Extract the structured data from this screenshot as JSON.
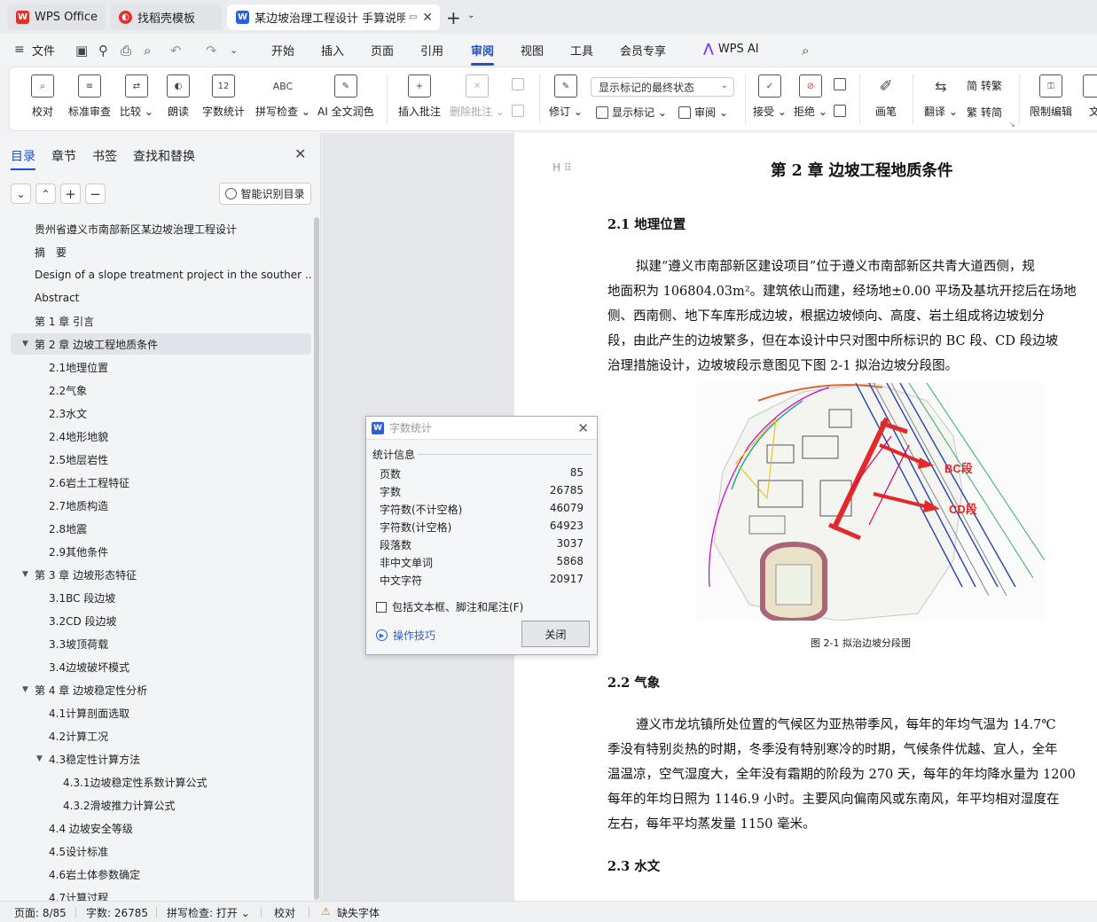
{
  "tabs": [
    {
      "label": "WPS Office",
      "icon": "wps-logo-icon"
    },
    {
      "label": "找稻壳模板",
      "icon": "docer-icon"
    },
    {
      "label": "某边坡治理工程设计 手算说明",
      "icon": "writer-doc-icon",
      "active": true
    }
  ],
  "menu": {
    "file": "文件",
    "items": [
      "开始",
      "插入",
      "页面",
      "引用",
      "审阅",
      "视图",
      "工具",
      "会员专享"
    ],
    "active": "审阅",
    "ai": "WPS AI"
  },
  "ribbon": {
    "proofread": "校对",
    "standard_review": "标准审查",
    "compare": "比较",
    "read_aloud": "朗读",
    "word_count": "字数统计",
    "spell_check": "拼写检查",
    "ai_polish": "AI 全文润色",
    "insert_comment": "插入批注",
    "delete_comment": "删除批注",
    "track_changes": "修订",
    "show_markup": "显示标记",
    "review": "审阅",
    "markup_state": "显示标记的最终状态",
    "accept": "接受",
    "reject": "拒绝",
    "pen": "画笔",
    "translate": "翻译",
    "to_traditional": "转繁",
    "to_simplified": "转简",
    "restrict_edit": "限制编辑",
    "doc_more": "文"
  },
  "nav": {
    "tabs": [
      "目录",
      "章节",
      "书签",
      "查找和替换"
    ],
    "smart_toc": "智能识别目录",
    "toc": [
      {
        "label": "贵州省遵义市南部新区某边坡治理工程设计",
        "level": 1
      },
      {
        "label": "摘　要",
        "level": 1
      },
      {
        "label": "Design of a slope treatment project in the souther ...",
        "level": 1
      },
      {
        "label": "Abstract",
        "level": 1
      },
      {
        "label": "第 1 章  引言",
        "level": 1
      },
      {
        "label": "第 2 章  边坡工程地质条件",
        "level": 1,
        "expand": true,
        "selected": true
      },
      {
        "label": "2.1地理位置",
        "level": 2
      },
      {
        "label": "2.2气象",
        "level": 2
      },
      {
        "label": "2.3水文",
        "level": 2
      },
      {
        "label": "2.4地形地貌",
        "level": 2
      },
      {
        "label": "2.5地层岩性",
        "level": 2
      },
      {
        "label": "2.6岩土工程特征",
        "level": 2
      },
      {
        "label": "2.7地质构造",
        "level": 2
      },
      {
        "label": "2.8地震",
        "level": 2
      },
      {
        "label": "2.9其他条件",
        "level": 2
      },
      {
        "label": "第 3 章  边坡形态特征",
        "level": 1,
        "expand": true
      },
      {
        "label": "3.1BC 段边坡",
        "level": 2
      },
      {
        "label": "3.2CD 段边坡",
        "level": 2
      },
      {
        "label": "3.3坡顶荷载",
        "level": 2
      },
      {
        "label": "3.4边坡破坏模式",
        "level": 2
      },
      {
        "label": "第 4 章  边坡稳定性分析",
        "level": 1,
        "expand": true
      },
      {
        "label": "4.1计算剖面选取",
        "level": 2
      },
      {
        "label": "4.2计算工况",
        "level": 2
      },
      {
        "label": "4.3稳定性计算方法",
        "level": 2,
        "expand": true
      },
      {
        "label": "4.3.1边坡稳定性系数计算公式",
        "level": 3
      },
      {
        "label": "4.3.2滑坡推力计算公式",
        "level": 3
      },
      {
        "label": "4.4  边坡安全等级",
        "level": 2
      },
      {
        "label": "4.5设计标准",
        "level": 2
      },
      {
        "label": "4.6岩土体参数确定",
        "level": 2
      },
      {
        "label": "4.7计算过程",
        "level": 2
      }
    ]
  },
  "doc": {
    "chapter_title": "第 2 章  边坡工程地质条件",
    "sec1": "2.1  地理位置",
    "p1": [
      "拟建“遵义市南部新区建设项目”位于遵义市南部新区共青大道西侧，规",
      "地面积为 106804.03m²。建筑依山而建，经场地±0.00 平场及基坑开挖后在场地",
      "侧、西南侧、地下车库形成边坡，根据边坡倾向、高度、岩土组成将边坡划分",
      "段，由此产生的边坡繁多，但在本设计中只对图中所标识的 BC 段、CD 段边坡",
      "治理措施设计，边坡坡段示意图见下图 2-1 拟治边坡分段图。"
    ],
    "map_labels": [
      "BC段",
      "CD段"
    ],
    "caption": "图 2-1  拟治边坡分段图",
    "sec2": "2.2  气象",
    "p2": [
      "遵义市龙坑镇所处位置的气候区为亚热带季风，每年的年均气温为 14.7℃",
      "季没有特别炎热的时期，冬季没有特别寒冷的时期，气候条件优越、宜人，全年",
      "温温凉，空气湿度大，全年没有霜期的阶段为 270 天，每年的年均降水量为 1200",
      "每年的年均日照为 1146.9 小时。主要风向偏南风或东南风，年平均相对湿度在",
      "左右，每年平均蒸发量 1150 毫米。"
    ],
    "sec3": "2.3  水文"
  },
  "dialog": {
    "title": "字数统计",
    "group": "统计信息",
    "stats": [
      {
        "label": "页数",
        "value": "85"
      },
      {
        "label": "字数",
        "value": "26785"
      },
      {
        "label": "字符数(不计空格)",
        "value": "46079"
      },
      {
        "label": "字符数(计空格)",
        "value": "64923"
      },
      {
        "label": "段落数",
        "value": "3037"
      },
      {
        "label": "非中文单词",
        "value": "5868"
      },
      {
        "label": "中文字符",
        "value": "20917"
      }
    ],
    "include_label": "包括文本框、脚注和尾注(F)",
    "tips": "操作技巧",
    "close": "关闭"
  },
  "status": {
    "page": "页面: 8/85",
    "words": "字数: 26785",
    "spell": "拼写检查: 打开",
    "proof": "校对",
    "missing_font": "缺失字体"
  },
  "colors": {
    "accent": "#1f4fcf",
    "wps_red": "#e2312d",
    "arrow_red": "#e32a2a"
  }
}
